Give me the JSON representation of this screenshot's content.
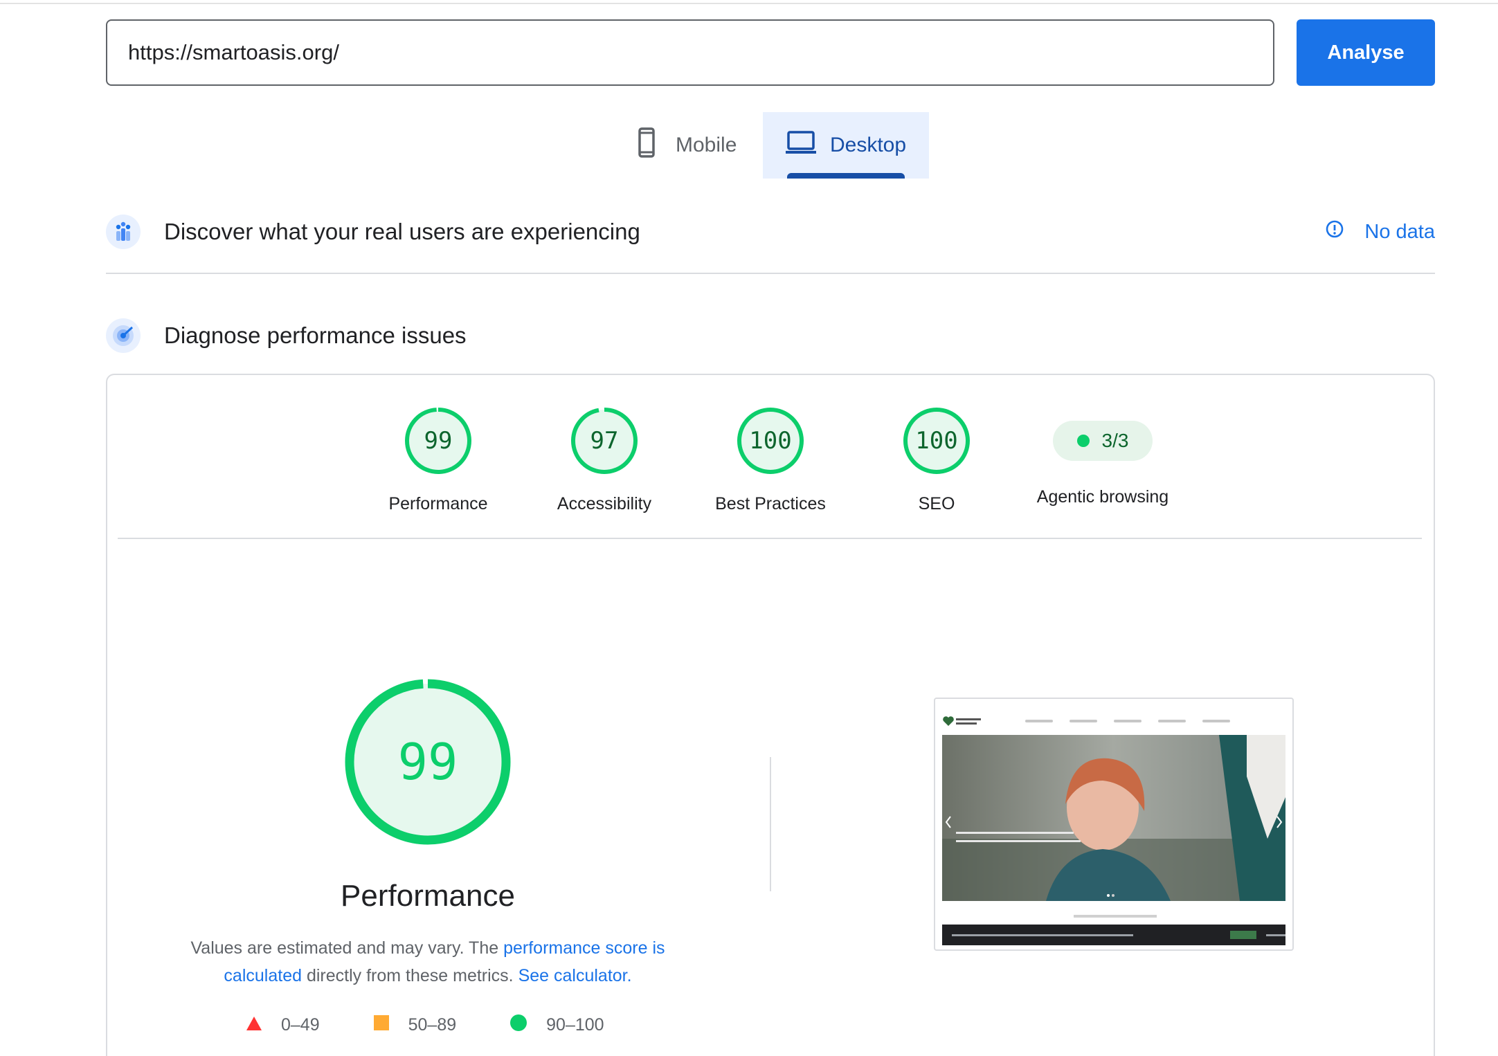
{
  "url_bar": {
    "value": "https://smartoasis.org/",
    "analyse_label": "Analyse"
  },
  "device_tabs": [
    {
      "label": "Mobile",
      "icon": "phone-icon",
      "selected": false
    },
    {
      "label": "Desktop",
      "icon": "laptop-icon",
      "selected": true
    }
  ],
  "field_data": {
    "title": "Discover what your real users are experiencing",
    "icon": "users-chart-icon",
    "status_label": "No data",
    "status_icon": "info-icon"
  },
  "lab_data": {
    "title": "Diagnose performance issues",
    "icon": "target-icon"
  },
  "category_scores": [
    {
      "label": "Performance",
      "value": "99",
      "score": 99
    },
    {
      "label": "Accessibility",
      "value": "97",
      "score": 97
    },
    {
      "label": "Best Practices",
      "value": "100",
      "score": 100
    },
    {
      "label": "SEO",
      "value": "100",
      "score": 100
    },
    {
      "label": "Agentic browsing",
      "value": "3/3"
    }
  ],
  "performance": {
    "score": "99",
    "score_value": 99,
    "title": "Performance",
    "desc_prefix": "Values are estimated and may vary. The ",
    "desc_link1": "performance score is calculated",
    "desc_middle": " directly from these metrics. ",
    "desc_link2": "See calculator."
  },
  "legend": [
    {
      "range": "0–49",
      "marker": "red-triangle",
      "color": "#ff3333"
    },
    {
      "range": "50–89",
      "marker": "orange-square",
      "color": "#ffaa33"
    },
    {
      "range": "90–100",
      "marker": "green-circle",
      "color": "#0cce6b"
    }
  ],
  "colors": {
    "accent": "#1a73e8",
    "good": "#0cce6b",
    "good_text": "#0d652d"
  }
}
